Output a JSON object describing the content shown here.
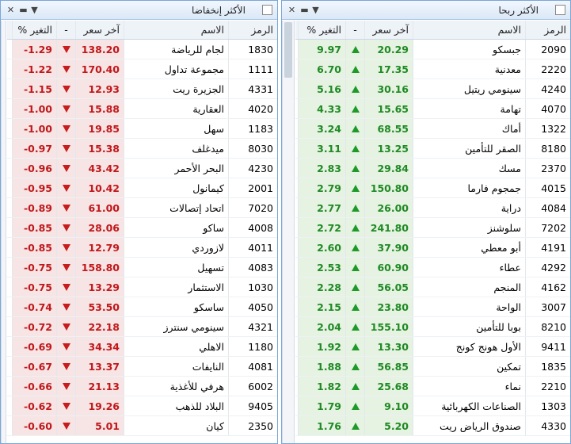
{
  "gainers": {
    "title": "الأكثر ربحا",
    "headers": {
      "code": "الرمز",
      "name": "الاسم",
      "price": "آخر سعر",
      "arrow": "-",
      "change": "التغير %"
    },
    "rows": [
      {
        "code": "2090",
        "name": "جبسكو",
        "price": "20.29",
        "change": "9.97"
      },
      {
        "code": "2220",
        "name": "معدنية",
        "price": "17.35",
        "change": "6.70"
      },
      {
        "code": "4240",
        "name": "سينومي ريتيل",
        "price": "30.16",
        "change": "5.16"
      },
      {
        "code": "4070",
        "name": "تهامة",
        "price": "15.65",
        "change": "4.33"
      },
      {
        "code": "1322",
        "name": "أماك",
        "price": "68.55",
        "change": "3.24"
      },
      {
        "code": "8180",
        "name": "الصقر للتأمين",
        "price": "13.25",
        "change": "3.11"
      },
      {
        "code": "2370",
        "name": "مسك",
        "price": "29.84",
        "change": "2.83"
      },
      {
        "code": "4015",
        "name": "جمجوم فارما",
        "price": "150.80",
        "change": "2.79"
      },
      {
        "code": "4084",
        "name": "دراية",
        "price": "26.00",
        "change": "2.77"
      },
      {
        "code": "7202",
        "name": "سلوشنز",
        "price": "241.80",
        "change": "2.72"
      },
      {
        "code": "4191",
        "name": "أبو معطي",
        "price": "37.90",
        "change": "2.60"
      },
      {
        "code": "4292",
        "name": "عطاء",
        "price": "60.90",
        "change": "2.53"
      },
      {
        "code": "4162",
        "name": "المنجم",
        "price": "56.05",
        "change": "2.28"
      },
      {
        "code": "3007",
        "name": "الواحة",
        "price": "23.80",
        "change": "2.15"
      },
      {
        "code": "8210",
        "name": "بوبا للتأمين",
        "price": "155.10",
        "change": "2.04"
      },
      {
        "code": "9411",
        "name": "الأول هونج كونج",
        "price": "13.30",
        "change": "1.92"
      },
      {
        "code": "1835",
        "name": "تمكين",
        "price": "56.85",
        "change": "1.88"
      },
      {
        "code": "2210",
        "name": "نماء",
        "price": "25.68",
        "change": "1.82"
      },
      {
        "code": "1303",
        "name": "الصناعات الكهربائية",
        "price": "9.10",
        "change": "1.79"
      },
      {
        "code": "4330",
        "name": "صندوق الرياض ريت",
        "price": "5.20",
        "change": "1.76"
      }
    ]
  },
  "losers": {
    "title": "الأكثر إنخفاضا",
    "headers": {
      "code": "الرمز",
      "name": "الاسم",
      "price": "آخر سعر",
      "arrow": "-",
      "change": "التغير %"
    },
    "rows": [
      {
        "code": "1830",
        "name": "لجام للرياضة",
        "price": "138.20",
        "change": "-1.29"
      },
      {
        "code": "1111",
        "name": "مجموعة تداول",
        "price": "170.40",
        "change": "-1.22"
      },
      {
        "code": "4331",
        "name": "الجزيرة ريت",
        "price": "12.93",
        "change": "-1.15"
      },
      {
        "code": "4020",
        "name": "العقارية",
        "price": "15.88",
        "change": "-1.00"
      },
      {
        "code": "1183",
        "name": "سهل",
        "price": "19.85",
        "change": "-1.00"
      },
      {
        "code": "8030",
        "name": "ميدغلف",
        "price": "15.38",
        "change": "-0.97"
      },
      {
        "code": "4230",
        "name": "البحر الأحمر",
        "price": "43.42",
        "change": "-0.96"
      },
      {
        "code": "2001",
        "name": "كيمانول",
        "price": "10.42",
        "change": "-0.95"
      },
      {
        "code": "7020",
        "name": "اتحاد إتصالات",
        "price": "61.00",
        "change": "-0.89"
      },
      {
        "code": "4008",
        "name": "ساكو",
        "price": "28.06",
        "change": "-0.85"
      },
      {
        "code": "4011",
        "name": "لازوردي",
        "price": "12.79",
        "change": "-0.85"
      },
      {
        "code": "4083",
        "name": "تسهيل",
        "price": "158.80",
        "change": "-0.75"
      },
      {
        "code": "1030",
        "name": "الاستثمار",
        "price": "13.29",
        "change": "-0.75"
      },
      {
        "code": "4050",
        "name": "ساسكو",
        "price": "53.50",
        "change": "-0.74"
      },
      {
        "code": "4321",
        "name": "سينومي سنترز",
        "price": "22.18",
        "change": "-0.72"
      },
      {
        "code": "1180",
        "name": "الاهلي",
        "price": "34.34",
        "change": "-0.69"
      },
      {
        "code": "4081",
        "name": "النايفات",
        "price": "13.37",
        "change": "-0.67"
      },
      {
        "code": "6002",
        "name": "هرفي للأغذية",
        "price": "21.13",
        "change": "-0.66"
      },
      {
        "code": "9405",
        "name": "البلاد للذهب",
        "price": "19.26",
        "change": "-0.62"
      },
      {
        "code": "2350",
        "name": "كيان",
        "price": "5.01",
        "change": "-0.60"
      }
    ]
  },
  "colors": {
    "up": "#1f8a24",
    "down": "#c0181b",
    "up_bg": "#e6f2e2",
    "down_bg": "#f7e4e4"
  },
  "titlebar_icons": [
    "close-icon",
    "minimize-icon",
    "dropdown-icon",
    "checkbox-icon"
  ]
}
